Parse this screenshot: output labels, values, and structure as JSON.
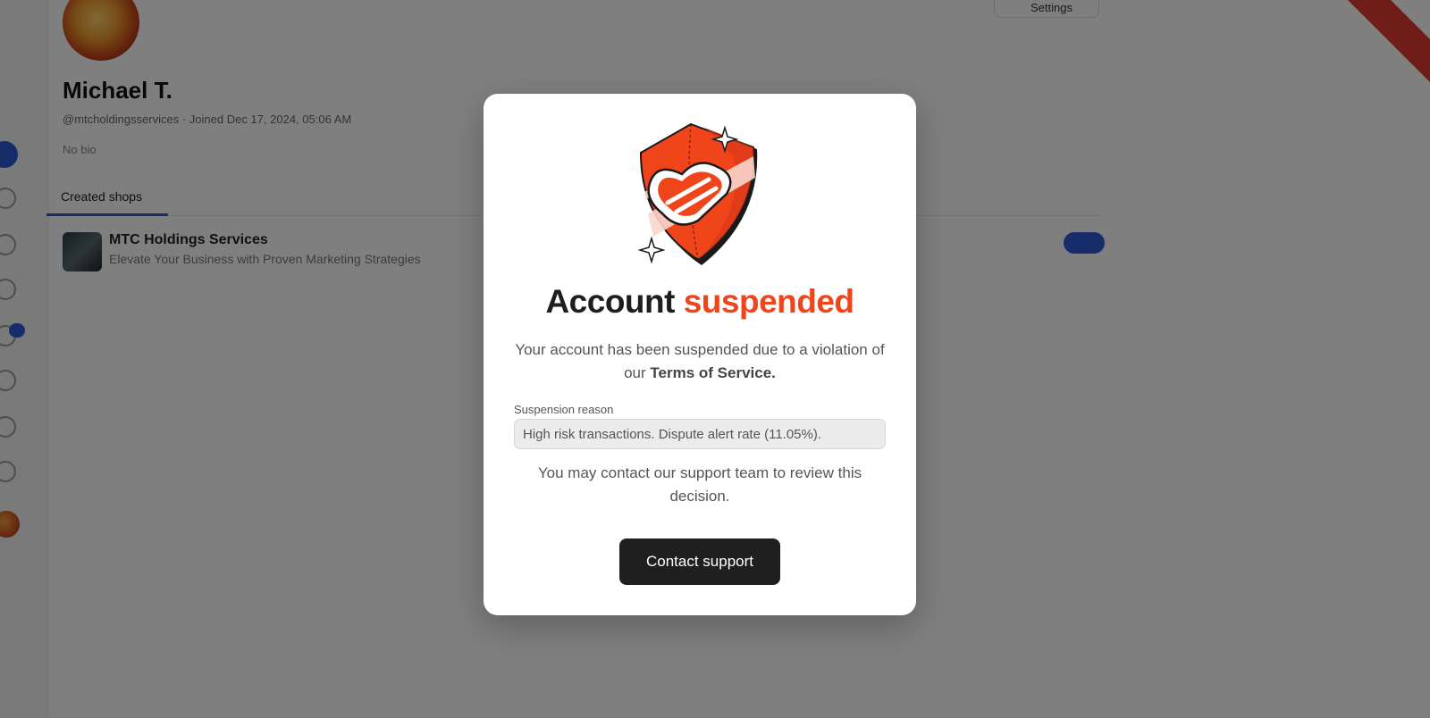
{
  "background": {
    "profile": {
      "name": "Michael T.",
      "meta": "@mtcholdingsservices  ·  Joined Dec 17, 2024, 05:06 AM",
      "bio": "No bio"
    },
    "settings_label": "Settings",
    "tabs": [
      {
        "label": "Created shops"
      }
    ],
    "shops": [
      {
        "title": "MTC Holdings Services",
        "subtitle": "Elevate Your Business with Proven Marketing Strategies"
      }
    ]
  },
  "modal": {
    "icon": "shield-icon",
    "title": {
      "prefix": "Account",
      "accent": "suspended"
    },
    "description": {
      "text": "Your account has been suspended due to a violation of our",
      "link": "Terms of Service."
    },
    "reason": {
      "label": "Suspension reason",
      "value": "High risk transactions. Dispute alert rate (11.05%)."
    },
    "note": "You may contact our support team to review this decision.",
    "button": {
      "label": "Contact support"
    }
  },
  "colors": {
    "accent": "#f0441b",
    "button": "#1f1f1f",
    "overlay": "rgba(0,0,0,0.5)",
    "brand_blue": "#2f5bd3"
  }
}
